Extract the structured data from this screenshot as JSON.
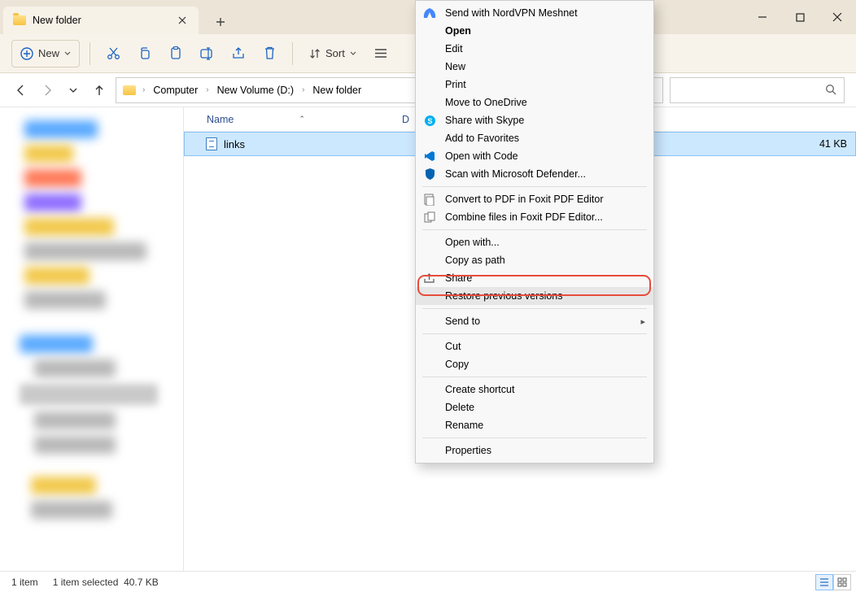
{
  "window": {
    "tab_title": "New folder"
  },
  "toolbar": {
    "new_label": "New",
    "sort_label": "Sort"
  },
  "breadcrumbs": {
    "c0": "Computer",
    "c1": "New Volume (D:)",
    "c2": "New folder"
  },
  "columns": {
    "name": "Name",
    "size_partial": "D"
  },
  "file": {
    "name": "links",
    "size": "41 KB"
  },
  "context_menu": {
    "i0": "Send with NordVPN Meshnet",
    "i1": "Open",
    "i2": "Edit",
    "i3": "New",
    "i4": "Print",
    "i5": "Move to OneDrive",
    "i6": "Share with Skype",
    "i7": "Add to Favorites",
    "i8": "Open with Code",
    "i9": "Scan with Microsoft Defender...",
    "i10": "Convert to PDF in Foxit PDF Editor",
    "i11": "Combine files in Foxit PDF Editor...",
    "i12": "Open with...",
    "i13": "Copy as path",
    "i14": "Share",
    "i15": "Restore previous versions",
    "i16": "Send to",
    "i17": "Cut",
    "i18": "Copy",
    "i19": "Create shortcut",
    "i20": "Delete",
    "i21": "Rename",
    "i22": "Properties"
  },
  "status": {
    "count": "1 item",
    "selected": "1 item selected",
    "size": "40.7 KB"
  }
}
